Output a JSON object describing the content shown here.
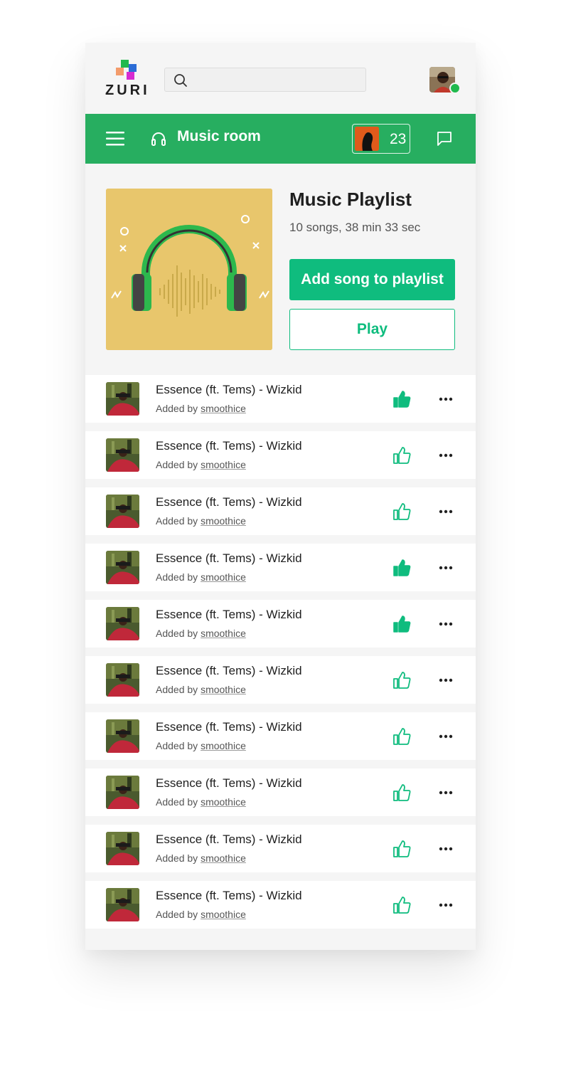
{
  "app": {
    "logo_text": "ZURI",
    "logo_icon": "zuri-blocks-logo",
    "colors": {
      "brand_green": "#27ae60",
      "accent_green": "#0fbc7e",
      "online": "#1fb94d"
    }
  },
  "header": {
    "search_placeholder": "",
    "search_icon": "search-icon",
    "avatar_icon": "user-avatar",
    "online_status": "online"
  },
  "room_bar": {
    "menu_icon": "hamburger-menu-icon",
    "room_icon": "headphones-icon",
    "room_name": "Music room",
    "member_count": "23",
    "chat_icon": "chat-bubble-icon"
  },
  "playlist": {
    "title": "Music Playlist",
    "meta": "10 songs, 38 min 33 sec",
    "add_button": "Add song to playlist",
    "play_button": "Play",
    "cover_icon": "headphones-soundwave-art"
  },
  "songs": [
    {
      "title": "Essence (ft. Tems) - Wizkid",
      "added_by_label": "Added by",
      "user": "smoothice",
      "liked": true
    },
    {
      "title": "Essence (ft. Tems) - Wizkid",
      "added_by_label": "Added by",
      "user": "smoothice",
      "liked": false
    },
    {
      "title": "Essence (ft. Tems) - Wizkid",
      "added_by_label": "Added by",
      "user": "smoothice",
      "liked": false
    },
    {
      "title": "Essence (ft. Tems) - Wizkid",
      "added_by_label": "Added by",
      "user": "smoothice",
      "liked": true
    },
    {
      "title": "Essence (ft. Tems) - Wizkid",
      "added_by_label": "Added by",
      "user": "smoothice",
      "liked": true
    },
    {
      "title": "Essence (ft. Tems) - Wizkid",
      "added_by_label": "Added by",
      "user": "smoothice",
      "liked": false
    },
    {
      "title": "Essence (ft. Tems) - Wizkid",
      "added_by_label": "Added by",
      "user": "smoothice",
      "liked": false
    },
    {
      "title": "Essence (ft. Tems) - Wizkid",
      "added_by_label": "Added by",
      "user": "smoothice",
      "liked": false
    },
    {
      "title": "Essence (ft. Tems) - Wizkid",
      "added_by_label": "Added by",
      "user": "smoothice",
      "liked": false
    },
    {
      "title": "Essence (ft. Tems) - Wizkid",
      "added_by_label": "Added by",
      "user": "smoothice",
      "liked": false
    }
  ]
}
